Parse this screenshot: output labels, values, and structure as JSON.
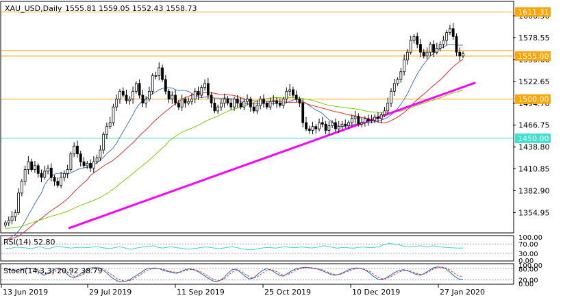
{
  "chart_data": {
    "type": "candlestick",
    "symbol_label": "XAU_USD,Daily",
    "ohlc_label": "1555.81 1559.05 1552.43 1558.73",
    "ohlc": {
      "open": 1555.81,
      "high": 1559.05,
      "low": 1552.43,
      "close": 1558.73
    },
    "x_ticks": [
      "13 Jun 2019",
      "29 Jul 2019",
      "11 Sep 2019",
      "25 Oct 2019",
      "10 Dec 2019",
      "27 Jan 2020"
    ],
    "y_range": [
      1330.0,
      1624.0
    ],
    "y_ticks": [
      "1606.50",
      "1578.55",
      "1550.60",
      "1522.65",
      "1494.70",
      "1466.75",
      "1438.80",
      "1410.85",
      "1382.90",
      "1354.95"
    ],
    "price_labels": [
      "1611.31",
      "1555.00",
      "1500.00",
      "1450.00"
    ],
    "levels": [
      {
        "value": 1611.31,
        "label": "1611.31",
        "color": "#ffa500"
      },
      {
        "value": 1562.0,
        "label": "",
        "color": "#ffa500"
      },
      {
        "value": 1555.0,
        "label": "1555.00",
        "color": "#ffa500"
      },
      {
        "value": 1500.0,
        "label": "1500.00",
        "color": "#ffa500"
      },
      {
        "value": 1450.0,
        "label": "1450.00",
        "color": "#40e0d0"
      }
    ],
    "trendline": {
      "start_value": 1335,
      "end_value": 1521,
      "color": "#ff00ff"
    },
    "moving_averages": [
      {
        "color": "#4a72b8",
        "start": 1320,
        "end": 1553
      },
      {
        "color": "#e03030",
        "start": 1320,
        "end": 1536
      },
      {
        "color": "#7ccd00",
        "start": 1335,
        "end": 1508
      }
    ],
    "candles_close": [
      1342,
      1345,
      1350,
      1355,
      1380,
      1395,
      1410,
      1420,
      1410,
      1415,
      1405,
      1400,
      1408,
      1412,
      1400,
      1395,
      1390,
      1400,
      1405,
      1410,
      1430,
      1440,
      1430,
      1420,
      1415,
      1418,
      1412,
      1420,
      1425,
      1435,
      1455,
      1465,
      1470,
      1490,
      1500,
      1510,
      1505,
      1498,
      1500,
      1510,
      1520,
      1505,
      1495,
      1500,
      1510,
      1530,
      1530,
      1540,
      1525,
      1510,
      1500,
      1505,
      1495,
      1490,
      1500,
      1495,
      1497,
      1500,
      1510,
      1505,
      1515,
      1520,
      1505,
      1495,
      1485,
      1490,
      1495,
      1500,
      1495,
      1490,
      1500,
      1495,
      1490,
      1497,
      1500,
      1490,
      1485,
      1492,
      1500,
      1495,
      1490,
      1497,
      1498,
      1495,
      1492,
      1500,
      1510,
      1512,
      1505,
      1500,
      1495,
      1470,
      1462,
      1460,
      1465,
      1462,
      1470,
      1468,
      1460,
      1466,
      1470,
      1462,
      1465,
      1468,
      1466,
      1470,
      1475,
      1478,
      1468,
      1470,
      1475,
      1472,
      1473,
      1477,
      1475,
      1480,
      1485,
      1495,
      1510,
      1520,
      1525,
      1535,
      1550,
      1560,
      1575,
      1580,
      1570,
      1560,
      1555,
      1560,
      1570,
      1560,
      1565,
      1570,
      1575,
      1585,
      1590,
      1580,
      1560,
      1555,
      1558
    ],
    "rsi": {
      "label": "RSI(14) 52.80",
      "value": 52.8,
      "range": [
        0,
        100
      ],
      "levels": [
        70,
        30
      ],
      "tick_labels": [
        "100.00",
        "70.00",
        "30.00",
        "0.00"
      ],
      "values": [
        52,
        50,
        55,
        56,
        54,
        52,
        50,
        55,
        58,
        52,
        50,
        56,
        60,
        57,
        55,
        52,
        54,
        56,
        55,
        54,
        57,
        58,
        55,
        52,
        50,
        54,
        58,
        55,
        50,
        48,
        52,
        55,
        58,
        60,
        62,
        56,
        52,
        55,
        58,
        55,
        52,
        50,
        48,
        50,
        52,
        55,
        57,
        55,
        52,
        50,
        52,
        56,
        58,
        55,
        50,
        47,
        45,
        46,
        50,
        53,
        55,
        54,
        52,
        55,
        58,
        56,
        54,
        55,
        57,
        55,
        53,
        54,
        58,
        62,
        60,
        56,
        52,
        54,
        55,
        53,
        52,
        55,
        57,
        55,
        54,
        56,
        60,
        68,
        72,
        70,
        68,
        62,
        60,
        58,
        60,
        62,
        60,
        58,
        62,
        60,
        57,
        55,
        54,
        53,
        52,
        53
      ]
    },
    "stoch": {
      "label": "Stoch(14,3,3) 20.92 38.79",
      "main": 20.92,
      "signal": 38.79,
      "range": [
        0,
        100
      ],
      "levels": [
        80,
        20
      ],
      "tick_labels": [
        "100.00",
        "80.00",
        "20.00",
        "0.00"
      ],
      "main_values": [
        80,
        75,
        70,
        65,
        80,
        85,
        82,
        78,
        60,
        45,
        55,
        70,
        82,
        80,
        60,
        40,
        30,
        45,
        60,
        75,
        85,
        86,
        84,
        70,
        50,
        30,
        15,
        10,
        12,
        20,
        35,
        50,
        65,
        80,
        82,
        85,
        80,
        70,
        65,
        60,
        55,
        65,
        75,
        80,
        75,
        65,
        50,
        35,
        20,
        10,
        15,
        30,
        55,
        75,
        78,
        60,
        40,
        25,
        30,
        50,
        70,
        80,
        75,
        60,
        45,
        40,
        55,
        70,
        80,
        85,
        88,
        86,
        82,
        78,
        70,
        60,
        50,
        45,
        50,
        60,
        72,
        80,
        85,
        82,
        75,
        60,
        40,
        25,
        20,
        30,
        45,
        60,
        70,
        75,
        70,
        60,
        50,
        45,
        55,
        70,
        85,
        90,
        88,
        80,
        60,
        40,
        25,
        21
      ],
      "signal_values": [
        78,
        77,
        72,
        68,
        74,
        80,
        83,
        80,
        70,
        55,
        52,
        60,
        72,
        78,
        72,
        55,
        40,
        38,
        48,
        62,
        76,
        84,
        85,
        78,
        62,
        45,
        28,
        18,
        13,
        15,
        26,
        40,
        55,
        70,
        79,
        82,
        82,
        76,
        70,
        64,
        60,
        62,
        70,
        76,
        76,
        70,
        58,
        45,
        30,
        20,
        16,
        22,
        42,
        62,
        72,
        68,
        52,
        38,
        30,
        38,
        55,
        70,
        76,
        70,
        56,
        46,
        48,
        62,
        74,
        82,
        86,
        87,
        84,
        80,
        74,
        66,
        56,
        49,
        48,
        55,
        65,
        75,
        82,
        83,
        78,
        68,
        52,
        36,
        26,
        26,
        36,
        50,
        62,
        70,
        72,
        66,
        56,
        49,
        52,
        64,
        78,
        87,
        89,
        84,
        72,
        55,
        40,
        39
      ]
    }
  }
}
